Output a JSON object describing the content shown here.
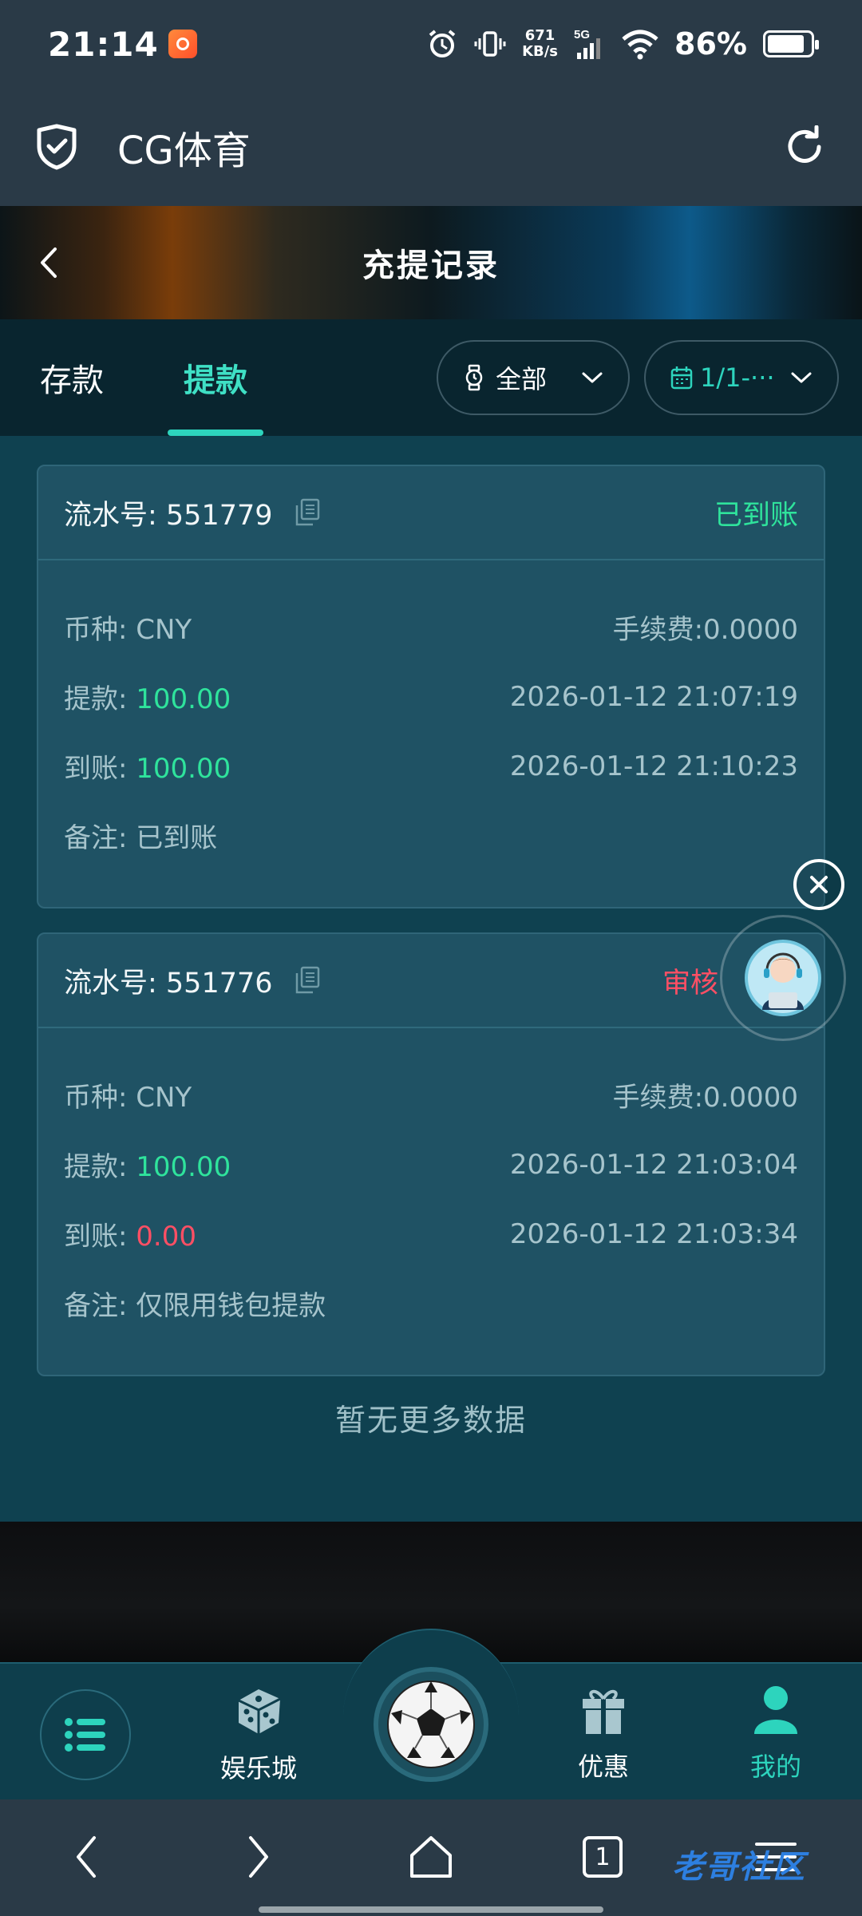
{
  "status_bar": {
    "time": "21:14",
    "net_speed_value": "671",
    "net_speed_unit": "KB/s",
    "network": "5G",
    "battery": "86%",
    "battery_level": 0.86
  },
  "app_header": {
    "title": "CG体育"
  },
  "page": {
    "title": "充提记录"
  },
  "tabs": {
    "deposit": "存款",
    "withdraw": "提款",
    "active": "withdraw"
  },
  "filters": {
    "status_value": "全部",
    "date_value": "1/1-···"
  },
  "records": [
    {
      "serial_label": "流水号: 551779",
      "status": "已到账",
      "currency_label": "币种: CNY",
      "fee_label": "手续费:0.0000",
      "withdraw_prefix": "提款: ",
      "withdraw_amount": "100.00",
      "withdraw_time": "2026-01-12 21:07:19",
      "arrive_prefix": "到账: ",
      "arrive_amount": "100.00",
      "arrive_time": "2026-01-12 21:10:23",
      "note_label": "备注: 已到账"
    },
    {
      "serial_label": "流水号: 551776",
      "status": "审核",
      "currency_label": "币种: CNY",
      "fee_label": "手续费:0.0000",
      "withdraw_prefix": "提款: ",
      "withdraw_amount": "100.00",
      "withdraw_time": "2026-01-12 21:03:04",
      "arrive_prefix": "到账: ",
      "arrive_amount": "0.00",
      "arrive_time": "2026-01-12 21:03:34",
      "note_label": "备注: 仅限用钱包提款"
    }
  ],
  "list_footer": "暂无更多数据",
  "bottom_nav": {
    "casino": "娱乐城",
    "promo": "优惠",
    "mine": "我的"
  },
  "system_nav": {
    "tab_count": "1"
  },
  "watermark": "老哥社区",
  "colors": {
    "accent": "#2dd4bd",
    "success": "#2fe39c",
    "danger": "#ff4f64",
    "card_bg": "#1f5264"
  }
}
